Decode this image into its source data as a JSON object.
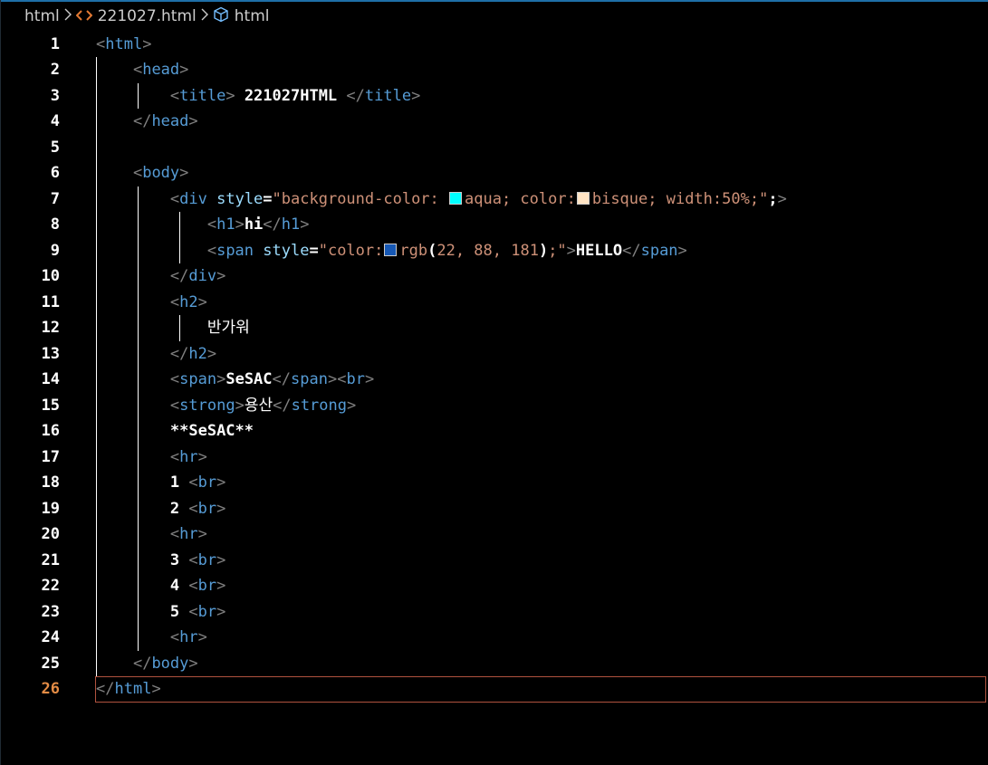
{
  "breadcrumb": {
    "items": [
      {
        "label": "html",
        "icon": "",
        "icon_color": ""
      },
      {
        "label": "221027.html",
        "icon": "html-file-icon",
        "icon_color": "#e37933"
      },
      {
        "label": "html",
        "icon": "element-cube-icon",
        "icon_color": "#75beff"
      }
    ]
  },
  "theme": {
    "background": "#000000",
    "tag_color": "#569cd6",
    "bracket_color": "#808080",
    "attribute_color": "#9cdcfe",
    "string_color": "#ce9178",
    "text_color": "#ffffff",
    "line_number_color": "#ffffff",
    "active_line_number_color": "#e48c45",
    "current_line_border": "#b0533f"
  },
  "editor": {
    "active_line": 26,
    "lines": [
      {
        "num": "1",
        "tokens": [
          {
            "t": "<",
            "c": "punct"
          },
          {
            "t": "html",
            "c": "tag"
          },
          {
            "t": ">",
            "c": "punct"
          }
        ]
      },
      {
        "num": "2",
        "tokens": [
          {
            "t": "    "
          },
          {
            "t": "<",
            "c": "punct"
          },
          {
            "t": "head",
            "c": "tag"
          },
          {
            "t": ">",
            "c": "punct"
          }
        ]
      },
      {
        "num": "3",
        "tokens": [
          {
            "t": "        "
          },
          {
            "t": "<",
            "c": "punct"
          },
          {
            "t": "title",
            "c": "tag"
          },
          {
            "t": ">",
            "c": "punct"
          },
          {
            "t": " 221027HTML ",
            "c": "text"
          },
          {
            "t": "</",
            "c": "punct"
          },
          {
            "t": "title",
            "c": "tag"
          },
          {
            "t": ">",
            "c": "punct"
          }
        ]
      },
      {
        "num": "4",
        "tokens": [
          {
            "t": "    "
          },
          {
            "t": "</",
            "c": "punct"
          },
          {
            "t": "head",
            "c": "tag"
          },
          {
            "t": ">",
            "c": "punct"
          }
        ]
      },
      {
        "num": "5",
        "tokens": []
      },
      {
        "num": "6",
        "tokens": [
          {
            "t": "    "
          },
          {
            "t": "<",
            "c": "punct"
          },
          {
            "t": "body",
            "c": "tag"
          },
          {
            "t": ">",
            "c": "punct"
          }
        ]
      },
      {
        "num": "7",
        "tokens": [
          {
            "t": "        "
          },
          {
            "t": "<",
            "c": "punct"
          },
          {
            "t": "div",
            "c": "tag"
          },
          {
            "t": " "
          },
          {
            "t": "style",
            "c": "attr"
          },
          {
            "t": "=",
            "c": "text"
          },
          {
            "t": "\"background-color: ",
            "c": "str"
          },
          {
            "swatch": "#00ffff"
          },
          {
            "t": "aqua; color:",
            "c": "str"
          },
          {
            "swatch": "#ffe4c4"
          },
          {
            "t": "bisque; width:50%;\"",
            "c": "str"
          },
          {
            "t": ";",
            "c": "text"
          },
          {
            "t": ">",
            "c": "punct"
          }
        ]
      },
      {
        "num": "8",
        "tokens": [
          {
            "t": "            "
          },
          {
            "t": "<",
            "c": "punct"
          },
          {
            "t": "h1",
            "c": "tag"
          },
          {
            "t": ">",
            "c": "punct"
          },
          {
            "t": "hi",
            "c": "text"
          },
          {
            "t": "</",
            "c": "punct"
          },
          {
            "t": "h1",
            "c": "tag"
          },
          {
            "t": ">",
            "c": "punct"
          }
        ]
      },
      {
        "num": "9",
        "tokens": [
          {
            "t": "            "
          },
          {
            "t": "<",
            "c": "punct"
          },
          {
            "t": "span",
            "c": "tag"
          },
          {
            "t": " "
          },
          {
            "t": "style",
            "c": "attr"
          },
          {
            "t": "=",
            "c": "text"
          },
          {
            "t": "\"color:",
            "c": "str"
          },
          {
            "swatch": "#1658b5"
          },
          {
            "t": "rgb",
            "c": "str"
          },
          {
            "t": "(",
            "c": "text"
          },
          {
            "t": "22, 88, 181",
            "c": "str"
          },
          {
            "t": ")",
            "c": "text"
          },
          {
            "t": ";\"",
            "c": "str"
          },
          {
            "t": ">",
            "c": "punct"
          },
          {
            "t": "HELLO",
            "c": "text"
          },
          {
            "t": "</",
            "c": "punct"
          },
          {
            "t": "span",
            "c": "tag"
          },
          {
            "t": ">",
            "c": "punct"
          }
        ]
      },
      {
        "num": "10",
        "tokens": [
          {
            "t": "        "
          },
          {
            "t": "</",
            "c": "punct"
          },
          {
            "t": "div",
            "c": "tag"
          },
          {
            "t": ">",
            "c": "punct"
          }
        ]
      },
      {
        "num": "11",
        "tokens": [
          {
            "t": "        "
          },
          {
            "t": "<",
            "c": "punct"
          },
          {
            "t": "h2",
            "c": "tag"
          },
          {
            "t": ">",
            "c": "punct"
          }
        ]
      },
      {
        "num": "12",
        "tokens": [
          {
            "t": "            "
          },
          {
            "t": "반가워",
            "c": "ktext"
          }
        ]
      },
      {
        "num": "13",
        "tokens": [
          {
            "t": "        "
          },
          {
            "t": "</",
            "c": "punct"
          },
          {
            "t": "h2",
            "c": "tag"
          },
          {
            "t": ">",
            "c": "punct"
          }
        ]
      },
      {
        "num": "14",
        "tokens": [
          {
            "t": "        "
          },
          {
            "t": "<",
            "c": "punct"
          },
          {
            "t": "span",
            "c": "tag"
          },
          {
            "t": ">",
            "c": "punct"
          },
          {
            "t": "SeSAC",
            "c": "text"
          },
          {
            "t": "</",
            "c": "punct"
          },
          {
            "t": "span",
            "c": "tag"
          },
          {
            "t": ">",
            "c": "punct"
          },
          {
            "t": "<",
            "c": "punct"
          },
          {
            "t": "br",
            "c": "tag"
          },
          {
            "t": ">",
            "c": "punct"
          }
        ]
      },
      {
        "num": "15",
        "tokens": [
          {
            "t": "        "
          },
          {
            "t": "<",
            "c": "punct"
          },
          {
            "t": "strong",
            "c": "tag"
          },
          {
            "t": ">",
            "c": "punct"
          },
          {
            "t": "용산",
            "c": "ktext"
          },
          {
            "t": "</",
            "c": "punct"
          },
          {
            "t": "strong",
            "c": "tag"
          },
          {
            "t": ">",
            "c": "punct"
          }
        ]
      },
      {
        "num": "16",
        "tokens": [
          {
            "t": "        "
          },
          {
            "t": "**SeSAC**",
            "c": "text"
          }
        ]
      },
      {
        "num": "17",
        "tokens": [
          {
            "t": "        "
          },
          {
            "t": "<",
            "c": "punct"
          },
          {
            "t": "hr",
            "c": "tag"
          },
          {
            "t": ">",
            "c": "punct"
          }
        ]
      },
      {
        "num": "18",
        "tokens": [
          {
            "t": "        "
          },
          {
            "t": "1 ",
            "c": "text"
          },
          {
            "t": "<",
            "c": "punct"
          },
          {
            "t": "br",
            "c": "tag"
          },
          {
            "t": ">",
            "c": "punct"
          }
        ]
      },
      {
        "num": "19",
        "tokens": [
          {
            "t": "        "
          },
          {
            "t": "2 ",
            "c": "text"
          },
          {
            "t": "<",
            "c": "punct"
          },
          {
            "t": "br",
            "c": "tag"
          },
          {
            "t": ">",
            "c": "punct"
          }
        ]
      },
      {
        "num": "20",
        "tokens": [
          {
            "t": "        "
          },
          {
            "t": "<",
            "c": "punct"
          },
          {
            "t": "hr",
            "c": "tag"
          },
          {
            "t": ">",
            "c": "punct"
          }
        ]
      },
      {
        "num": "21",
        "tokens": [
          {
            "t": "        "
          },
          {
            "t": "3 ",
            "c": "text"
          },
          {
            "t": "<",
            "c": "punct"
          },
          {
            "t": "br",
            "c": "tag"
          },
          {
            "t": ">",
            "c": "punct"
          }
        ]
      },
      {
        "num": "22",
        "tokens": [
          {
            "t": "        "
          },
          {
            "t": "4 ",
            "c": "text"
          },
          {
            "t": "<",
            "c": "punct"
          },
          {
            "t": "br",
            "c": "tag"
          },
          {
            "t": ">",
            "c": "punct"
          }
        ]
      },
      {
        "num": "23",
        "tokens": [
          {
            "t": "        "
          },
          {
            "t": "5 ",
            "c": "text"
          },
          {
            "t": "<",
            "c": "punct"
          },
          {
            "t": "br",
            "c": "tag"
          },
          {
            "t": ">",
            "c": "punct"
          }
        ]
      },
      {
        "num": "24",
        "tokens": [
          {
            "t": "        "
          },
          {
            "t": "<",
            "c": "punct"
          },
          {
            "t": "hr",
            "c": "tag"
          },
          {
            "t": ">",
            "c": "punct"
          }
        ]
      },
      {
        "num": "25",
        "tokens": [
          {
            "t": "    "
          },
          {
            "t": "</",
            "c": "punct"
          },
          {
            "t": "body",
            "c": "tag"
          },
          {
            "t": ">",
            "c": "punct"
          }
        ]
      },
      {
        "num": "26",
        "tokens": [
          {
            "t": "</",
            "c": "punct"
          },
          {
            "t": "html",
            "c": "tag"
          },
          {
            "t": ">",
            "c": "punct"
          }
        ]
      }
    ]
  }
}
